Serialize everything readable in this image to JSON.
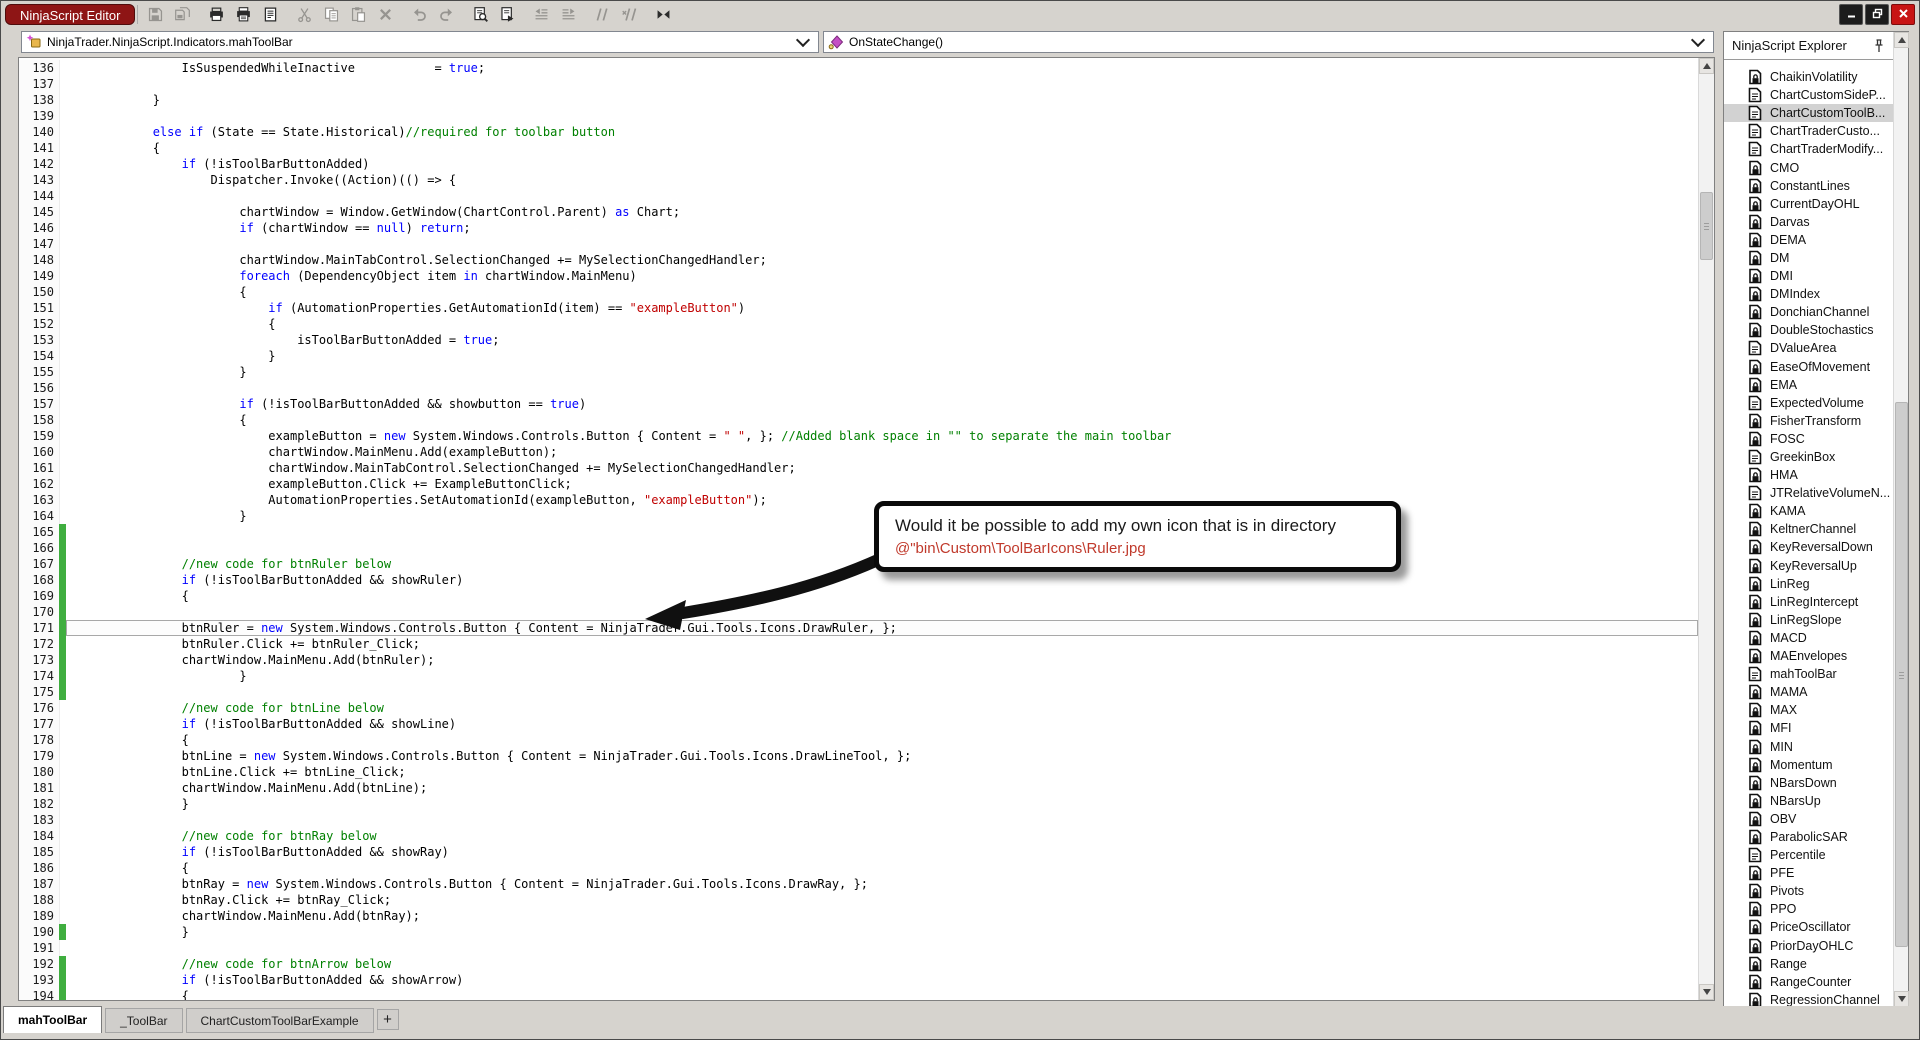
{
  "window": {
    "chip": "NinjaScript Editor",
    "controls": [
      {
        "name": "minimize-button",
        "icon": "minimize-icon"
      },
      {
        "name": "maximize-button",
        "icon": "maximize-icon"
      },
      {
        "name": "close-button",
        "icon": "close-icon"
      }
    ]
  },
  "colors": {
    "chip_bg": "#8e1515",
    "keyword": "#0000ff",
    "comment": "#008000",
    "string": "#c00000",
    "change_bar": "#3fae3f",
    "callout_path_red": "#c0392b",
    "close_button_red": "#c81414",
    "selected_item_bg": "#d2d2d2"
  },
  "toolbar": {
    "buttons": [
      {
        "name": "save",
        "enabled": false
      },
      {
        "name": "save-all",
        "enabled": false
      },
      {
        "name": "print",
        "enabled": true,
        "gap": true
      },
      {
        "name": "print-preview",
        "enabled": true
      },
      {
        "name": "page-setup",
        "enabled": true
      },
      {
        "name": "cut",
        "enabled": false,
        "gap": true
      },
      {
        "name": "copy",
        "enabled": false
      },
      {
        "name": "paste",
        "enabled": false
      },
      {
        "name": "delete",
        "enabled": false
      },
      {
        "name": "undo",
        "enabled": false,
        "gap": true
      },
      {
        "name": "redo",
        "enabled": false
      },
      {
        "name": "find",
        "enabled": true,
        "gap": true
      },
      {
        "name": "compile-run",
        "enabled": true
      },
      {
        "name": "outdent",
        "enabled": false,
        "gap": true
      },
      {
        "name": "indent",
        "enabled": false
      },
      {
        "name": "comment",
        "enabled": false,
        "gap": true
      },
      {
        "name": "uncomment",
        "enabled": false
      },
      {
        "name": "compile",
        "enabled": true,
        "gap": true
      }
    ]
  },
  "dropdowns": {
    "selected_class": "NinjaTrader.NinjaScript.Indicators.mahToolBar",
    "selected_method": "OnStateChange()"
  },
  "callout": {
    "line1": "Would it be possible to add my own icon that is in directory",
    "line2": "@\"bin\\Custom\\ToolBarIcons\\Ruler.jpg"
  },
  "editor": {
    "current_line": 171,
    "lines": [
      {
        "n": 136,
        "t": [
          [
            "p",
            "                IsSuspendedWhileInactive           = "
          ],
          [
            "k",
            "true"
          ],
          [
            "p",
            ";"
          ]
        ]
      },
      {
        "n": 137,
        "t": []
      },
      {
        "n": 138,
        "t": [
          [
            "p",
            "            }"
          ]
        ]
      },
      {
        "n": 139,
        "t": []
      },
      {
        "n": 140,
        "t": [
          [
            "p",
            "            "
          ],
          [
            "k",
            "else"
          ],
          [
            "p",
            " "
          ],
          [
            "k",
            "if"
          ],
          [
            "p",
            " (State == State.Historical)"
          ],
          [
            "c",
            "//required for toolbar button"
          ]
        ]
      },
      {
        "n": 141,
        "t": [
          [
            "p",
            "            {"
          ]
        ]
      },
      {
        "n": 142,
        "t": [
          [
            "p",
            "                "
          ],
          [
            "k",
            "if"
          ],
          [
            "p",
            " (!isToolBarButtonAdded)"
          ]
        ]
      },
      {
        "n": 143,
        "t": [
          [
            "p",
            "                    Dispatcher.Invoke((Action)(() => {"
          ]
        ]
      },
      {
        "n": 144,
        "t": []
      },
      {
        "n": 145,
        "t": [
          [
            "p",
            "                        chartWindow = Window.GetWindow(ChartControl.Parent) "
          ],
          [
            "k",
            "as"
          ],
          [
            "p",
            " Chart;"
          ]
        ]
      },
      {
        "n": 146,
        "t": [
          [
            "p",
            "                        "
          ],
          [
            "k",
            "if"
          ],
          [
            "p",
            " (chartWindow == "
          ],
          [
            "k",
            "null"
          ],
          [
            "p",
            ") "
          ],
          [
            "k",
            "return"
          ],
          [
            "p",
            ";"
          ]
        ]
      },
      {
        "n": 147,
        "t": []
      },
      {
        "n": 148,
        "t": [
          [
            "p",
            "                        chartWindow.MainTabControl.SelectionChanged += MySelectionChangedHandler;"
          ]
        ]
      },
      {
        "n": 149,
        "t": [
          [
            "p",
            "                        "
          ],
          [
            "k",
            "foreach"
          ],
          [
            "p",
            " (DependencyObject item "
          ],
          [
            "k",
            "in"
          ],
          [
            "p",
            " chartWindow.MainMenu)"
          ]
        ]
      },
      {
        "n": 150,
        "t": [
          [
            "p",
            "                        {"
          ]
        ]
      },
      {
        "n": 151,
        "t": [
          [
            "p",
            "                            "
          ],
          [
            "k",
            "if"
          ],
          [
            "p",
            " (AutomationProperties.GetAutomationId(item) == "
          ],
          [
            "s",
            "\"exampleButton\""
          ],
          [
            "p",
            ")"
          ]
        ]
      },
      {
        "n": 152,
        "t": [
          [
            "p",
            "                            {"
          ]
        ]
      },
      {
        "n": 153,
        "t": [
          [
            "p",
            "                                isToolBarButtonAdded = "
          ],
          [
            "k",
            "true"
          ],
          [
            "p",
            ";"
          ]
        ]
      },
      {
        "n": 154,
        "t": [
          [
            "p",
            "                            }"
          ]
        ]
      },
      {
        "n": 155,
        "t": [
          [
            "p",
            "                        }"
          ]
        ]
      },
      {
        "n": 156,
        "t": []
      },
      {
        "n": 157,
        "t": [
          [
            "p",
            "                        "
          ],
          [
            "k",
            "if"
          ],
          [
            "p",
            " (!isToolBarButtonAdded && showbutton == "
          ],
          [
            "k",
            "true"
          ],
          [
            "p",
            ")"
          ]
        ]
      },
      {
        "n": 158,
        "t": [
          [
            "p",
            "                        {"
          ]
        ]
      },
      {
        "n": 159,
        "t": [
          [
            "p",
            "                            exampleButton = "
          ],
          [
            "k",
            "new"
          ],
          [
            "p",
            " System.Windows.Controls.Button { Content = "
          ],
          [
            "s",
            "\" \""
          ],
          [
            "p",
            ", }; "
          ],
          [
            "c",
            "//Added blank space in \"\" to separate the main toolbar"
          ]
        ]
      },
      {
        "n": 160,
        "t": [
          [
            "p",
            "                            chartWindow.MainMenu.Add(exampleButton);"
          ]
        ]
      },
      {
        "n": 161,
        "t": [
          [
            "p",
            "                            chartWindow.MainTabControl.SelectionChanged += MySelectionChangedHandler;"
          ]
        ]
      },
      {
        "n": 162,
        "t": [
          [
            "p",
            "                            exampleButton.Click += ExampleButtonClick;"
          ]
        ]
      },
      {
        "n": 163,
        "t": [
          [
            "p",
            "                            AutomationProperties.SetAutomationId(exampleButton, "
          ],
          [
            "s",
            "\"exampleButton\""
          ],
          [
            "p",
            ");"
          ]
        ]
      },
      {
        "n": 164,
        "t": [
          [
            "p",
            "                        }"
          ]
        ]
      },
      {
        "n": 165,
        "g": true,
        "t": []
      },
      {
        "n": 166,
        "g": true,
        "t": []
      },
      {
        "n": 167,
        "g": true,
        "t": [
          [
            "p",
            "                "
          ],
          [
            "c",
            "//new code for btnRuler below"
          ]
        ]
      },
      {
        "n": 168,
        "g": true,
        "t": [
          [
            "p",
            "                "
          ],
          [
            "k",
            "if"
          ],
          [
            "p",
            " (!isToolBarButtonAdded && showRuler)"
          ]
        ]
      },
      {
        "n": 169,
        "g": true,
        "t": [
          [
            "p",
            "                {"
          ]
        ]
      },
      {
        "n": 170,
        "g": true,
        "t": []
      },
      {
        "n": 171,
        "g": true,
        "hl": true,
        "t": [
          [
            "p",
            "                btnRuler = "
          ],
          [
            "k",
            "new"
          ],
          [
            "p",
            " System.Windows.Controls.Button { Content = NinjaTrader.Gui.Tools.Icons.DrawRuler, };"
          ]
        ]
      },
      {
        "n": 172,
        "g": true,
        "t": [
          [
            "p",
            "                btnRuler.Click += btnRuler_Click;"
          ]
        ]
      },
      {
        "n": 173,
        "g": true,
        "t": [
          [
            "p",
            "                chartWindow.MainMenu.Add(btnRuler);"
          ]
        ]
      },
      {
        "n": 174,
        "g": true,
        "t": [
          [
            "p",
            "                        }"
          ]
        ]
      },
      {
        "n": 175,
        "g": true,
        "t": []
      },
      {
        "n": 176,
        "t": [
          [
            "p",
            "                "
          ],
          [
            "c",
            "//new code for btnLine below"
          ]
        ]
      },
      {
        "n": 177,
        "t": [
          [
            "p",
            "                "
          ],
          [
            "k",
            "if"
          ],
          [
            "p",
            " (!isToolBarButtonAdded && showLine)"
          ]
        ]
      },
      {
        "n": 178,
        "t": [
          [
            "p",
            "                {"
          ]
        ]
      },
      {
        "n": 179,
        "t": [
          [
            "p",
            "                btnLine = "
          ],
          [
            "k",
            "new"
          ],
          [
            "p",
            " System.Windows.Controls.Button { Content = NinjaTrader.Gui.Tools.Icons.DrawLineTool, };"
          ]
        ]
      },
      {
        "n": 180,
        "t": [
          [
            "p",
            "                btnLine.Click += btnLine_Click;"
          ]
        ]
      },
      {
        "n": 181,
        "t": [
          [
            "p",
            "                chartWindow.MainMenu.Add(btnLine);"
          ]
        ]
      },
      {
        "n": 182,
        "t": [
          [
            "p",
            "                }"
          ]
        ]
      },
      {
        "n": 183,
        "t": []
      },
      {
        "n": 184,
        "t": [
          [
            "p",
            "                "
          ],
          [
            "c",
            "//new code for btnRay below"
          ]
        ]
      },
      {
        "n": 185,
        "t": [
          [
            "p",
            "                "
          ],
          [
            "k",
            "if"
          ],
          [
            "p",
            " (!isToolBarButtonAdded && showRay)"
          ]
        ]
      },
      {
        "n": 186,
        "t": [
          [
            "p",
            "                {"
          ]
        ]
      },
      {
        "n": 187,
        "t": [
          [
            "p",
            "                btnRay = "
          ],
          [
            "k",
            "new"
          ],
          [
            "p",
            " System.Windows.Controls.Button { Content = NinjaTrader.Gui.Tools.Icons.DrawRay, };"
          ]
        ]
      },
      {
        "n": 188,
        "t": [
          [
            "p",
            "                btnRay.Click += btnRay_Click;"
          ]
        ]
      },
      {
        "n": 189,
        "t": [
          [
            "p",
            "                chartWindow.MainMenu.Add(btnRay);"
          ]
        ]
      },
      {
        "n": 190,
        "g": true,
        "t": [
          [
            "p",
            "                }"
          ]
        ]
      },
      {
        "n": 191,
        "t": []
      },
      {
        "n": 192,
        "g": true,
        "t": [
          [
            "p",
            "                "
          ],
          [
            "c",
            "//new code for btnArrow below"
          ]
        ]
      },
      {
        "n": 193,
        "g": true,
        "t": [
          [
            "p",
            "                "
          ],
          [
            "k",
            "if"
          ],
          [
            "p",
            " (!isToolBarButtonAdded && showArrow)"
          ]
        ]
      },
      {
        "n": 194,
        "g": true,
        "t": [
          [
            "p",
            "                {"
          ]
        ]
      }
    ]
  },
  "explorer": {
    "title": "NinjaScript Explorer",
    "items": [
      {
        "label": "ChaikinVolatility",
        "icon": "doc-lock"
      },
      {
        "label": "ChartCustomSideP...",
        "icon": "doc-lines"
      },
      {
        "label": "ChartCustomToolB...",
        "icon": "doc-lines",
        "selected": true
      },
      {
        "label": "ChartTraderCusto...",
        "icon": "doc-lines"
      },
      {
        "label": "ChartTraderModify...",
        "icon": "doc-lines"
      },
      {
        "label": "CMO",
        "icon": "doc-lock"
      },
      {
        "label": "ConstantLines",
        "icon": "doc-lock"
      },
      {
        "label": "CurrentDayOHL",
        "icon": "doc-lock"
      },
      {
        "label": "Darvas",
        "icon": "doc-lock"
      },
      {
        "label": "DEMA",
        "icon": "doc-lock"
      },
      {
        "label": "DM",
        "icon": "doc-lock"
      },
      {
        "label": "DMI",
        "icon": "doc-lock"
      },
      {
        "label": "DMIndex",
        "icon": "doc-lock"
      },
      {
        "label": "DonchianChannel",
        "icon": "doc-lock"
      },
      {
        "label": "DoubleStochastics",
        "icon": "doc-lock"
      },
      {
        "label": "DValueArea",
        "icon": "doc-lines"
      },
      {
        "label": "EaseOfMovement",
        "icon": "doc-lock"
      },
      {
        "label": "EMA",
        "icon": "doc-lock"
      },
      {
        "label": "ExpectedVolume",
        "icon": "doc-lines"
      },
      {
        "label": "FisherTransform",
        "icon": "doc-lock"
      },
      {
        "label": "FOSC",
        "icon": "doc-lock"
      },
      {
        "label": "GreekinBox",
        "icon": "doc-lines"
      },
      {
        "label": "HMA",
        "icon": "doc-lock"
      },
      {
        "label": "JTRelativeVolumeN...",
        "icon": "doc-lines"
      },
      {
        "label": "KAMA",
        "icon": "doc-lock"
      },
      {
        "label": "KeltnerChannel",
        "icon": "doc-lock"
      },
      {
        "label": "KeyReversalDown",
        "icon": "doc-lock"
      },
      {
        "label": "KeyReversalUp",
        "icon": "doc-lock"
      },
      {
        "label": "LinReg",
        "icon": "doc-lock"
      },
      {
        "label": "LinRegIntercept",
        "icon": "doc-lock"
      },
      {
        "label": "LinRegSlope",
        "icon": "doc-lock"
      },
      {
        "label": "MACD",
        "icon": "doc-lock"
      },
      {
        "label": "MAEnvelopes",
        "icon": "doc-lock"
      },
      {
        "label": "mahToolBar",
        "icon": "doc-lines"
      },
      {
        "label": "MAMA",
        "icon": "doc-lock"
      },
      {
        "label": "MAX",
        "icon": "doc-lock"
      },
      {
        "label": "MFI",
        "icon": "doc-lock"
      },
      {
        "label": "MIN",
        "icon": "doc-lock"
      },
      {
        "label": "Momentum",
        "icon": "doc-lock"
      },
      {
        "label": "NBarsDown",
        "icon": "doc-lock"
      },
      {
        "label": "NBarsUp",
        "icon": "doc-lock"
      },
      {
        "label": "OBV",
        "icon": "doc-lock"
      },
      {
        "label": "ParabolicSAR",
        "icon": "doc-lock"
      },
      {
        "label": "Percentile",
        "icon": "doc-lines"
      },
      {
        "label": "PFE",
        "icon": "doc-lock"
      },
      {
        "label": "Pivots",
        "icon": "doc-lock"
      },
      {
        "label": "PPO",
        "icon": "doc-lock"
      },
      {
        "label": "PriceOscillator",
        "icon": "doc-lock"
      },
      {
        "label": "PriorDayOHLC",
        "icon": "doc-lock"
      },
      {
        "label": "Range",
        "icon": "doc-lock"
      },
      {
        "label": "RangeCounter",
        "icon": "doc-lock"
      },
      {
        "label": "RegressionChannel",
        "icon": "doc-lock"
      }
    ]
  },
  "tabs": {
    "items": [
      {
        "label": "mahToolBar",
        "active": true
      },
      {
        "label": "_ToolBar",
        "active": false
      },
      {
        "label": "ChartCustomToolBarExample",
        "active": false
      }
    ],
    "add_label": "+"
  }
}
